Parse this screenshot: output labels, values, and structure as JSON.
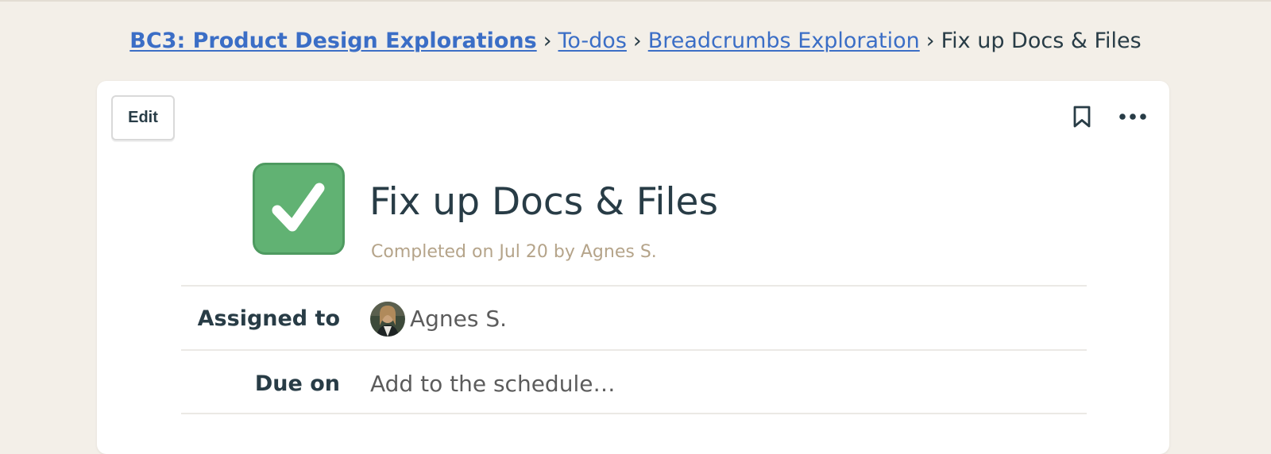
{
  "breadcrumb": {
    "items": [
      {
        "label": "BC3: Product Design Explorations"
      },
      {
        "label": "To-dos"
      },
      {
        "label": "Breadcrumbs Exploration"
      }
    ],
    "separator": "›",
    "current": "Fix up Docs & Files"
  },
  "toolbar": {
    "edit_label": "Edit",
    "bookmark_icon": "bookmark-icon",
    "more_icon": "ellipsis-icon"
  },
  "todo": {
    "title": "Fix up Docs & Files",
    "completed_text": "Completed on Jul 20 by Agnes S.",
    "checked": true,
    "check_icon": "checkmark-icon"
  },
  "details": {
    "assigned_label": "Assigned to",
    "assignee_name": "Agnes S.",
    "due_label": "Due on",
    "due_placeholder": "Add to the schedule…"
  },
  "colors": {
    "background": "#f3efe8",
    "link": "#3b6ec6",
    "text": "#283c46",
    "checkbox_green": "#61b273",
    "muted_tan": "#b5a48a"
  }
}
